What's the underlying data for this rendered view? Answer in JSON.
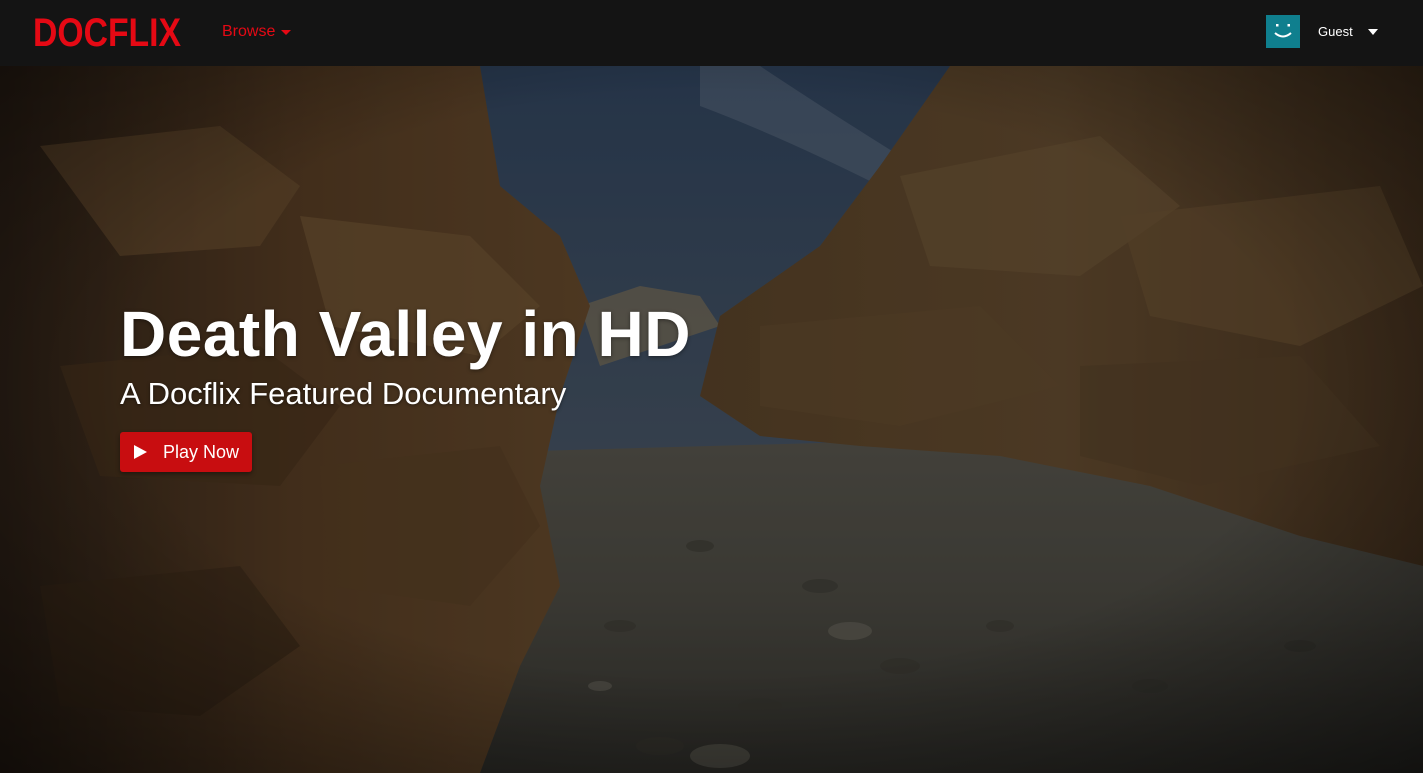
{
  "header": {
    "logo_text": "DOCFLIX",
    "browse_label": "Browse",
    "user": {
      "name": "Guest"
    }
  },
  "hero": {
    "title": "Death Valley in HD",
    "subtitle": "A Docflix Featured Documentary",
    "play_label": "Play Now"
  },
  "icons": {
    "browse_caret": "chevron-down-icon",
    "user_caret": "chevron-down-icon",
    "avatar": "smiley-avatar-icon",
    "play": "play-icon"
  },
  "colors": {
    "brand_red": "#e50914",
    "button_red": "#c80d10",
    "avatar_teal": "#0f7f8e",
    "topbar": "#141414"
  }
}
